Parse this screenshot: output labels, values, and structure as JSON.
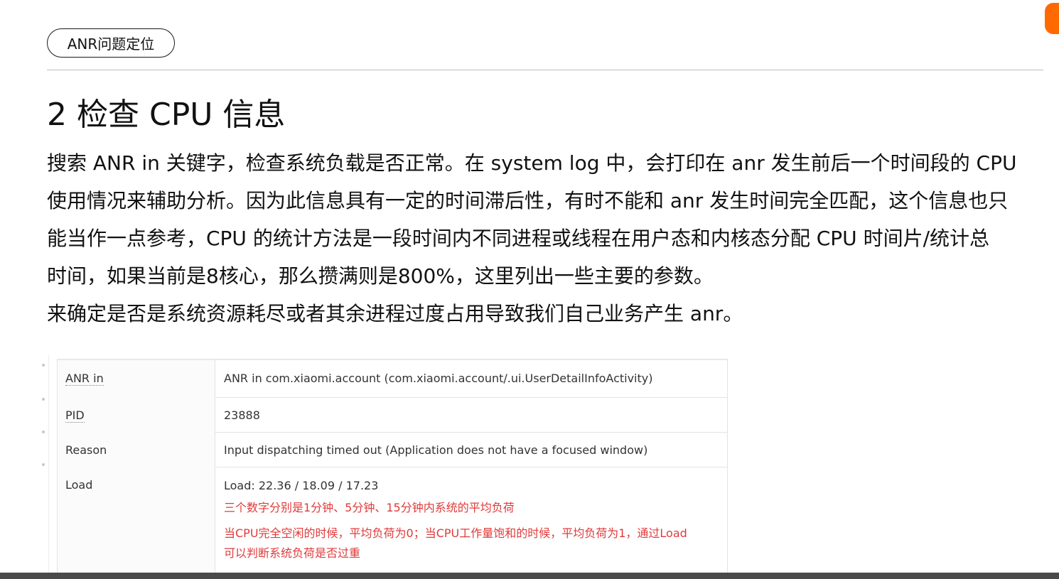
{
  "header": {
    "pill_label": "ANR问题定位"
  },
  "section": {
    "heading": "2 检查 CPU 信息",
    "paragraph_lines": [
      "搜索 ANR in 关键字，检查系统负载是否正常。在 system log 中，会打印在 anr 发生前后一个时间段的 CPU",
      "使用情况来辅助分析。因为此信息具有一定的时间滞后性，有时不能和 anr 发生时间完全匹配，这个信息也只",
      "能当作一点参考，CPU 的统计方法是一段时间内不同进程或线程在用户态和内核态分配 CPU 时间片/统计总",
      "时间，如果当前是8核心，那么攒满则是800%，这里列出一些主要的参数。",
      "来确定是否是系统资源耗尽或者其余进程过度占用导致我们自己业务产生 anr。"
    ]
  },
  "table": {
    "rows": [
      {
        "key": "ANR in",
        "value": "ANR in com.xiaomi.account (com.xiaomi.account/.ui.UserDetailInfoActivity)"
      },
      {
        "key": "PID",
        "value": "23888"
      },
      {
        "key": "Reason",
        "value": "Input dispatching timed out (Application does not have a focused window)"
      },
      {
        "key": "Load",
        "value": "Load: 22.36 / 18.09 / 17.23"
      }
    ],
    "load_notes": [
      "三个数字分别是1分钟、5分钟、15分钟内系统的平均负荷",
      "当CPU完全空闲的时候，平均负荷为0；当CPU工作量饱和的时候，平均负荷为1，通过Load",
      "可以判断系统负荷是否过重"
    ]
  },
  "colors": {
    "accent_logo": "#ff6a00",
    "note_red": "#e03a3a",
    "bottom_bar": "#4a4a4a"
  }
}
